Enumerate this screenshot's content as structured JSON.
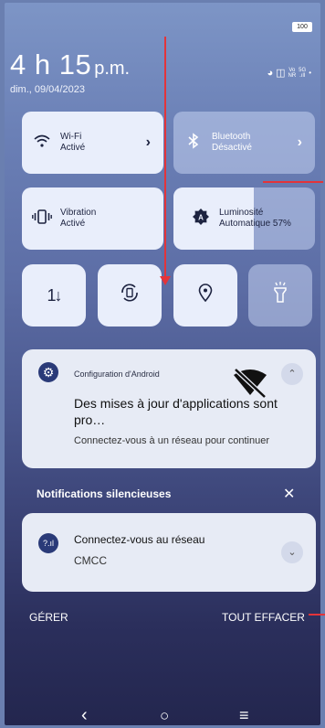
{
  "status_bar": {
    "battery": "100"
  },
  "clock": {
    "time": "4 h 15",
    "ampm": "p.m.",
    "date": "dim., 09/04/2023"
  },
  "status_icons": {
    "volte_top": "Vo",
    "volte_bottom": "NR",
    "five_g": "5G"
  },
  "tiles": {
    "wifi": {
      "name": "Wi-Fi",
      "state": "Activé"
    },
    "bluetooth": {
      "name": "Bluetooth",
      "state": "Désactivé"
    },
    "vibration": {
      "name": "Vibration",
      "state": "Activé"
    },
    "brightness": {
      "name": "Luminosité",
      "state": "Automatique 57%",
      "level": 0.57
    }
  },
  "quick_toggles": [
    {
      "icon": "data-transfer-icon",
      "glyph": "⇅"
    },
    {
      "icon": "auto-rotate-icon",
      "glyph": "⟳"
    },
    {
      "icon": "location-icon",
      "glyph": "⦿"
    },
    {
      "icon": "flashlight-icon",
      "glyph": "⚲"
    }
  ],
  "notification": {
    "app": "Configuration d'Android",
    "title": "Des mises à jour d'applications sont pro…",
    "text": "Connectez-vous à un réseau pour continuer"
  },
  "silent": {
    "header": "Notifications silencieuses"
  },
  "network_notification": {
    "title": "Connectez-vous au réseau",
    "subtitle": "CMCC"
  },
  "actions": {
    "manage": "GÉRER",
    "clear_all": "TOUT EFFACER"
  },
  "colors": {
    "accent": "#2a3a78",
    "annotation_red": "#e3343a"
  }
}
